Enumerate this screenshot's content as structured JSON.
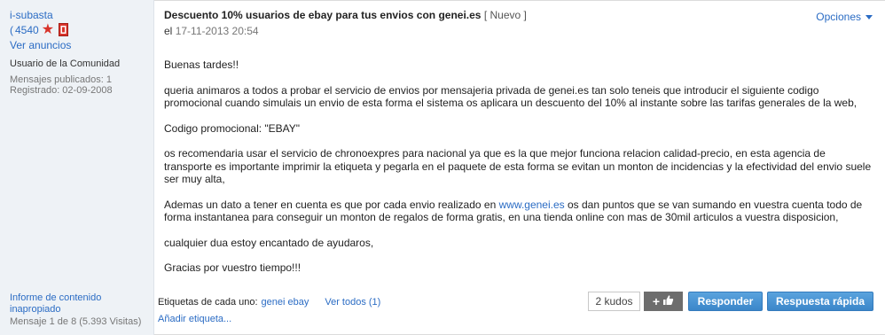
{
  "author": {
    "username": "i-subasta",
    "rank_open": "(",
    "rank_count": "4540",
    "role": "Usuario de la Comunidad",
    "posts": "Mensajes publicados: 1",
    "registered": "Registrado: 02-09-2008",
    "ads_link": "Ver anuncios"
  },
  "post": {
    "title": "Descuento 10% usuarios de ebay para tus envios con genei.es",
    "badge": "[ Nuevo ]",
    "date_prefix": "el",
    "date": "17-11-2013 20:54",
    "options_label": "Opciones",
    "paragraphs": {
      "p1": "Buenas tardes!!",
      "p2": "queria animaros a todos a probar el servicio de envios por mensajeria privada de genei.es tan solo teneis que introducir el siguiente codigo promocional cuando simulais un envio de esta forma el sistema os aplicara un descuento del 10% al instante sobre las tarifas generales de la web,",
      "p3": "Codigo promocional: \"EBAY\"",
      "p4": "os recomendaria usar el servicio de chronoexpres para nacional ya que es la que mejor funciona relacion calidad-precio, en esta agencia de transporte es importante imprimir la etiqueta y pegarla en el paquete de esta forma se evitan un monton de incidencias y la efectividad del envio suele ser muy alta,",
      "p5_before": "Ademas un dato a tener en cuenta es que por cada envio realizado en ",
      "p5_link": "www.genei.es",
      "p5_after": " os dan puntos que se van sumando en vuestra cuenta todo de forma instantanea para conseguir un monton de regalos de forma gratis, en una tienda online con mas de 30mil articulos a vuestra disposicion,",
      "p6": "cualquier dua estoy encantado de ayudaros,",
      "p7": "Gracias por vuestro tiempo!!!"
    }
  },
  "footer": {
    "report_link": "Informe de contenido inapropiado",
    "message_count": "Mensaje 1 de 8 (5.393 Visitas)",
    "tags_label": "Etiquetas de cada uno:",
    "tags_values": "genei ebay",
    "see_all": "Ver todos (1)",
    "add_tag": "Añadir etiqueta...",
    "kudos": "2 kudos",
    "kudo_plus": "+",
    "reply_label": "Responder",
    "quick_reply_label": "Respuesta rápida"
  },
  "colors": {
    "link": "#2b6cc4",
    "sidebar_bg": "#eef2f6",
    "button_blue": "#3b86c9",
    "star": "#d8332a"
  }
}
